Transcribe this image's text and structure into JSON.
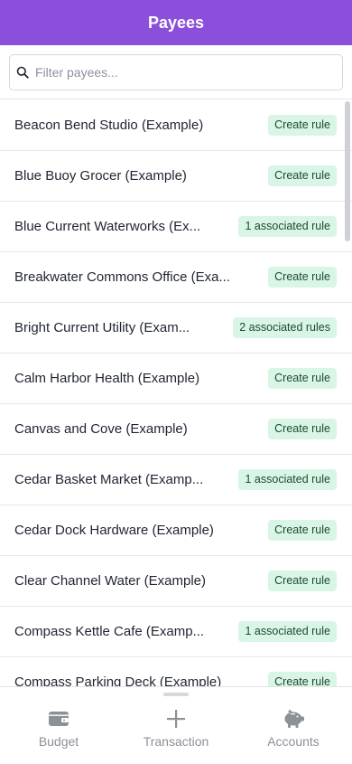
{
  "colors": {
    "accent": "#8b4fdc",
    "badge_bg": "#d9f5e6"
  },
  "header": {
    "title": "Payees"
  },
  "filter": {
    "placeholder": "Filter payees...",
    "icon": "search-icon"
  },
  "payees": [
    {
      "name": "Beacon Bend Studio (Example)",
      "badge": "Create rule"
    },
    {
      "name": "Blue Buoy Grocer (Example)",
      "badge": "Create rule"
    },
    {
      "name": "Blue Current Waterworks (Ex...",
      "badge": "1 associated rule"
    },
    {
      "name": "Breakwater Commons Office (Exa...",
      "badge": "Create rule"
    },
    {
      "name": "Bright Current Utility (Exam...",
      "badge": "2 associated rules"
    },
    {
      "name": "Calm Harbor Health (Example)",
      "badge": "Create rule"
    },
    {
      "name": "Canvas and Cove (Example)",
      "badge": "Create rule"
    },
    {
      "name": "Cedar Basket Market (Examp...",
      "badge": "1 associated rule"
    },
    {
      "name": "Cedar Dock Hardware (Example)",
      "badge": "Create rule"
    },
    {
      "name": "Clear Channel Water (Example)",
      "badge": "Create rule"
    },
    {
      "name": "Compass Kettle Cafe (Examp...",
      "badge": "1 associated rule"
    },
    {
      "name": "Compass Parking Deck (Example)",
      "badge": "Create rule"
    }
  ],
  "nav": {
    "budget": {
      "label": "Budget",
      "icon": "wallet-icon"
    },
    "transaction": {
      "label": "Transaction",
      "icon": "plus-icon"
    },
    "accounts": {
      "label": "Accounts",
      "icon": "piggy-bank-icon"
    }
  }
}
